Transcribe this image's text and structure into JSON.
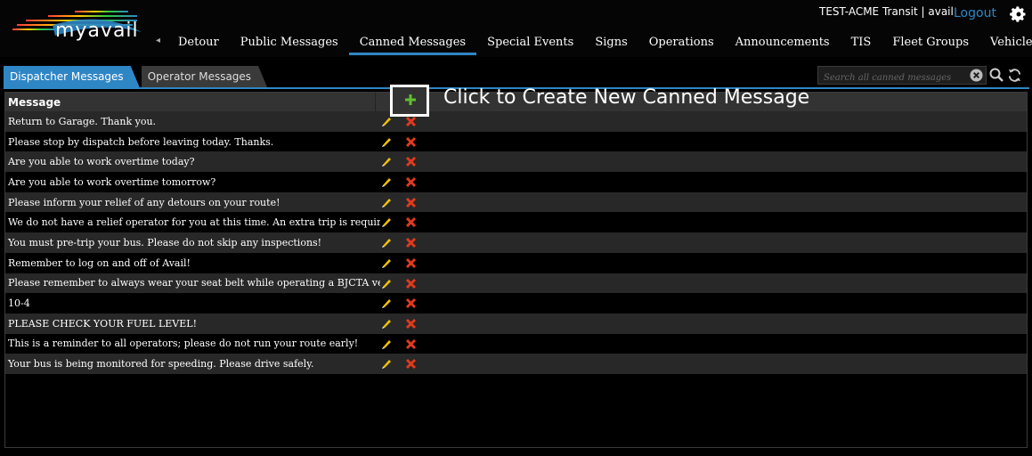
{
  "app": {
    "logo_text": "myavail",
    "user_info": "TEST-ACME Transit | avail",
    "logout_label": "Logout"
  },
  "nav": {
    "items": [
      {
        "label": "Detour",
        "active": false
      },
      {
        "label": "Public Messages",
        "active": false
      },
      {
        "label": "Canned Messages",
        "active": true
      },
      {
        "label": "Special Events",
        "active": false
      },
      {
        "label": "Signs",
        "active": false
      },
      {
        "label": "Operations",
        "active": false
      },
      {
        "label": "Announcements",
        "active": false
      },
      {
        "label": "TIS",
        "active": false
      },
      {
        "label": "Fleet Groups",
        "active": false
      },
      {
        "label": "Vehicle",
        "active": false
      }
    ]
  },
  "tabs": [
    {
      "label": "Dispatcher Messages",
      "active": true
    },
    {
      "label": "Operator Messages",
      "active": false
    }
  ],
  "search": {
    "placeholder": "Search all canned messages"
  },
  "table": {
    "header": "Message",
    "rows": [
      "Return to Garage. Thank you.",
      "Please stop by dispatch before leaving today. Thanks.",
      "Are you able to work overtime today?",
      "Are you able to work overtime tomorrow?",
      "Please inform your relief of any detours on your route!",
      "We do not have a relief operator for you at this time. An extra trip is required",
      "You must pre-trip your bus. Please do not skip any inspections!",
      "Remember to log on and off of Avail!",
      "Please remember to always wear your seat belt while operating a BJCTA vehicle.",
      "10-4",
      "PLEASE CHECK YOUR FUEL LEVEL!",
      "This is a reminder to all operators; please do not run your route early!",
      "Your bus is being monitored for speeding. Please drive safely."
    ]
  },
  "annotation": {
    "callout": "Click to Create New Canned Message"
  },
  "icons": {
    "add": "plus-icon",
    "edit": "pencil-icon",
    "delete": "x-icon",
    "search": "search-icon",
    "refresh": "refresh-icon",
    "settings": "gear-icon"
  },
  "colors": {
    "accent": "#2f86c5",
    "add": "#5fbf2f",
    "delete": "#e03a1e",
    "edit": "#f2c200"
  }
}
